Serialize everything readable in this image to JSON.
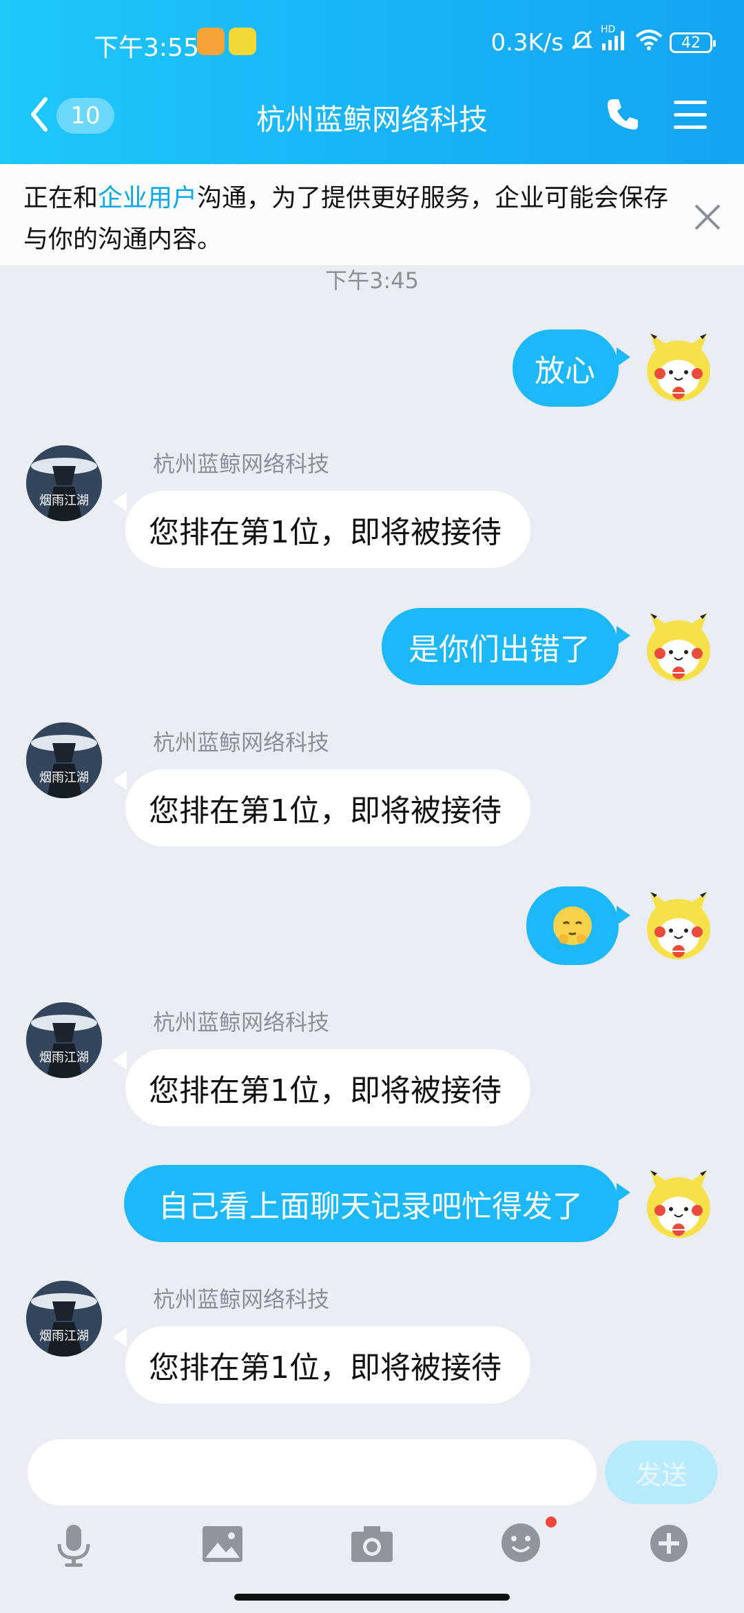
{
  "status_bar": {
    "time": "下午3:55",
    "network_speed": "0.3K/s",
    "signal_label": "HD",
    "battery": "42"
  },
  "header": {
    "unread_count": "10",
    "title": "杭州蓝鲸网络科技"
  },
  "notice": {
    "prefix": "正在和",
    "link": "企业用户",
    "suffix": "沟通，为了提供更好服务，企业可能会保存与你的沟通内容。"
  },
  "chat": {
    "timestamp": "下午3:45",
    "sender_name": "杭州蓝鲸网络科技",
    "avatar_text": "烟雨江湖",
    "messages": [
      {
        "side": "right",
        "text": "放心"
      },
      {
        "side": "left",
        "text": "您排在第1位，即将被接待"
      },
      {
        "side": "right",
        "text": "是你们出错了"
      },
      {
        "side": "left",
        "text": "您排在第1位，即将被接待"
      },
      {
        "side": "right",
        "text": "[emoji]"
      },
      {
        "side": "left",
        "text": "您排在第1位，即将被接待"
      },
      {
        "side": "right",
        "text": "自己看上面聊天记录吧忙得发了"
      },
      {
        "side": "left",
        "text": "您排在第1位，即将被接待"
      }
    ]
  },
  "input": {
    "placeholder": "",
    "send_label": "发送"
  },
  "toolbar": {
    "icons": [
      "microphone-icon",
      "image-icon",
      "camera-icon",
      "emoji-icon",
      "plus-icon"
    ]
  },
  "colors": {
    "header_start": "#1ec8fb",
    "header_end": "#14a4f2",
    "outgoing_bubble": "#1db8f7",
    "link": "#0aa6e6",
    "background": "#eaedf4"
  }
}
